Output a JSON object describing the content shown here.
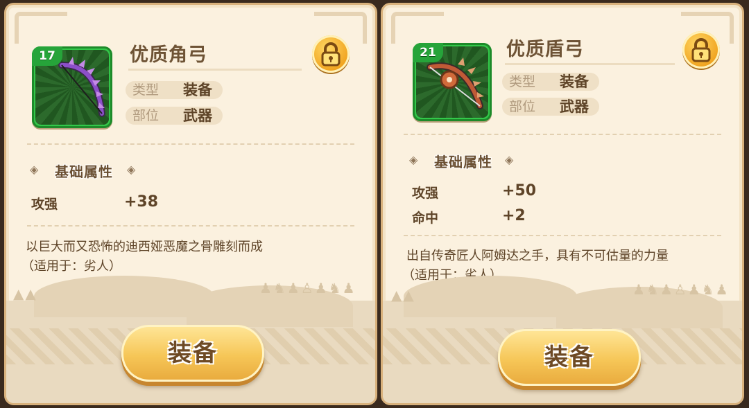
{
  "cards": [
    {
      "level": "17",
      "name": "优质角弓",
      "type_label": "类型",
      "type_value": "装备",
      "slot_label": "部位",
      "slot_value": "武器",
      "section_title": "基础属性",
      "stats": [
        {
          "label": "攻强",
          "value": "+38"
        }
      ],
      "desc_line1": "以巨大而又恐怖的迪西娅恶魔之骨雕刻而成",
      "desc_line2": "（适用于：劣人）",
      "button_label": "装备",
      "icon": "purple-spiked-bow-icon"
    },
    {
      "level": "21",
      "name": "优质盾弓",
      "type_label": "类型",
      "type_value": "装备",
      "slot_label": "部位",
      "slot_value": "武器",
      "section_title": "基础属性",
      "stats": [
        {
          "label": "攻强",
          "value": "+50"
        },
        {
          "label": "命中",
          "value": "+2"
        }
      ],
      "desc_line1": "出自传奇匠人阿姆达之手，具有不可估量的力量",
      "desc_line2": "（适用于：劣人）",
      "button_label": "装备",
      "icon": "orange-shield-bow-icon"
    }
  ],
  "colors": {
    "card_bg": "#fbf1df",
    "border": "#d9b27d",
    "text_dark": "#5e4428",
    "icon_frame_green": "#33c84a",
    "button_gold": "#f6c657",
    "lock_gold": "#f0a21d"
  }
}
